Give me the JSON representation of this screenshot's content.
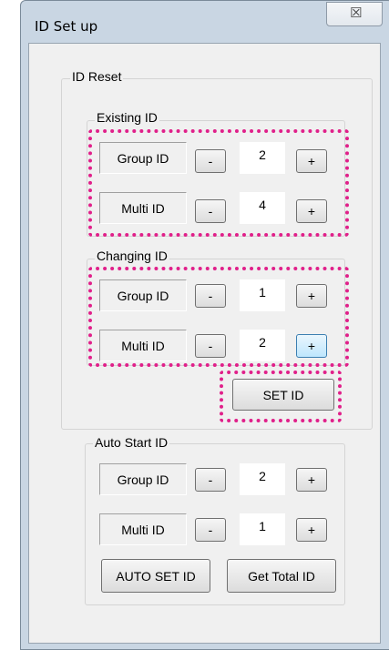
{
  "window": {
    "title": "ID Set up",
    "close_glyph": "☒"
  },
  "id_reset": {
    "label": "ID Reset",
    "existing": {
      "label": "Existing ID",
      "group": {
        "label": "Group ID",
        "value": "2"
      },
      "multi": {
        "label": "Multi ID",
        "value": "4"
      }
    },
    "changing": {
      "label": "Changing ID",
      "group": {
        "label": "Group ID",
        "value": "1"
      },
      "multi": {
        "label": "Multi ID",
        "value": "2"
      }
    },
    "set_button": "SET ID"
  },
  "auto_start": {
    "label": "Auto Start ID",
    "group": {
      "label": "Group ID",
      "value": "2"
    },
    "multi": {
      "label": "Multi ID",
      "value": "1"
    },
    "auto_set_button": "AUTO SET ID",
    "get_total_button": "Get Total ID"
  },
  "buttons": {
    "minus": "-",
    "plus": "+"
  },
  "highlight_color": "#e0208a"
}
